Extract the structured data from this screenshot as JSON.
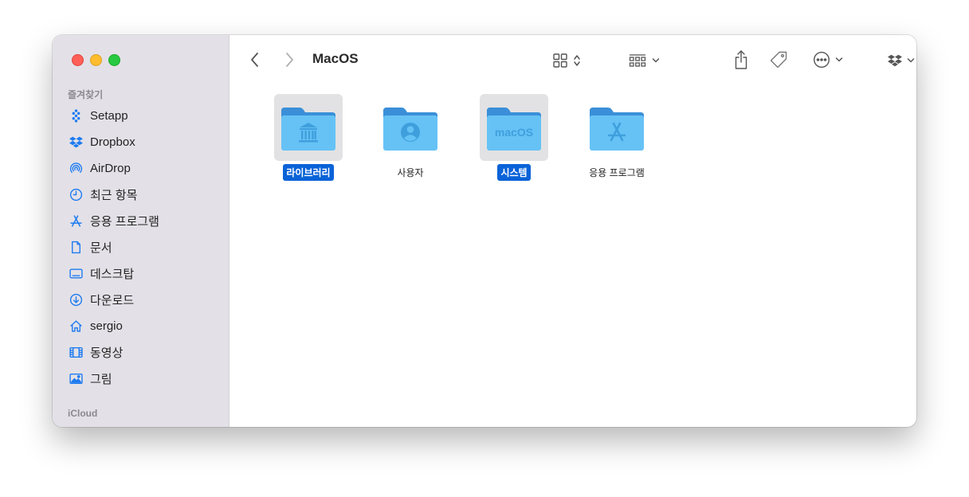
{
  "window": {
    "title": "MacOS"
  },
  "sidebar": {
    "favorites_title": "즐겨찾기",
    "icloud_title": "iCloud",
    "accent_color": "#1e7bf0",
    "items": [
      {
        "label": "Setapp",
        "icon": "setapp-icon"
      },
      {
        "label": "Dropbox",
        "icon": "dropbox-icon"
      },
      {
        "label": "AirDrop",
        "icon": "airdrop-icon"
      },
      {
        "label": "최근 항목",
        "icon": "clock-icon"
      },
      {
        "label": "응용 프로그램",
        "icon": "applications-icon"
      },
      {
        "label": "문서",
        "icon": "document-icon"
      },
      {
        "label": "데스크탑",
        "icon": "desktop-icon"
      },
      {
        "label": "다운로드",
        "icon": "download-icon"
      },
      {
        "label": "sergio",
        "icon": "home-icon"
      },
      {
        "label": "동영상",
        "icon": "movie-icon"
      },
      {
        "label": "그림",
        "icon": "picture-icon"
      }
    ]
  },
  "toolbar": {
    "icons": [
      "back-icon",
      "forward-icon",
      "grid-view-icon",
      "group-icon",
      "share-icon",
      "tag-icon",
      "more-icon",
      "dropbox-icon",
      "search-icon"
    ]
  },
  "items": [
    {
      "label": "라이브러리",
      "selected": true,
      "icon": "library-folder-icon"
    },
    {
      "label": "사용자",
      "selected": false,
      "icon": "users-folder-icon"
    },
    {
      "label": "시스템",
      "selected": true,
      "icon": "system-folder-icon",
      "badge_text": "macOS"
    },
    {
      "label": "응용 프로그램",
      "selected": false,
      "icon": "applications-folder-icon"
    }
  ]
}
